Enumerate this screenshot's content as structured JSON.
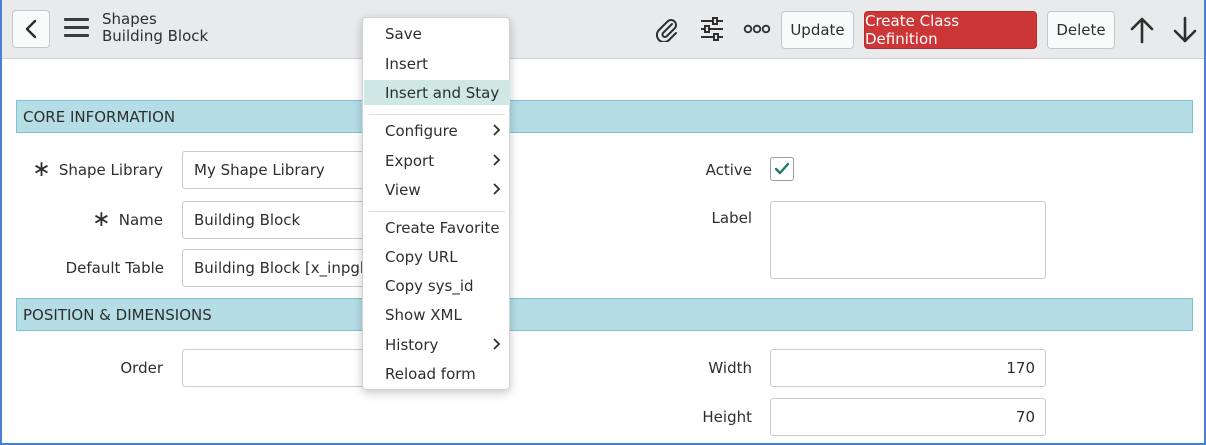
{
  "header": {
    "title": "Shapes",
    "subtitle": "Building Block",
    "update_label": "Update",
    "create_label": "Create Class Definition",
    "delete_label": "Delete",
    "icons": [
      "chevron-left-icon",
      "menu-icon",
      "paperclip-icon",
      "sliders-icon",
      "more-icon",
      "arrow-up-icon",
      "arrow-down-icon"
    ],
    "accent_color": "#cc3636"
  },
  "sections": {
    "core": "CORE INFORMATION",
    "position": "POSITION & DIMENSIONS",
    "section_color": "#b5dde6"
  },
  "form": {
    "shape_library": {
      "label": "Shape Library",
      "value": "My Shape Library",
      "required": true
    },
    "name": {
      "label": "Name",
      "value": "Building Block",
      "required": true
    },
    "default_table": {
      "label": "Default Table",
      "value": "Building Block [x_inpgh_u"
    },
    "active": {
      "label": "Active",
      "checked": true
    },
    "label_field": {
      "label": "Label",
      "value": ""
    },
    "order": {
      "label": "Order",
      "value": ""
    },
    "width": {
      "label": "Width",
      "value": "170"
    },
    "height": {
      "label": "Height",
      "value": "70"
    }
  },
  "context_menu": {
    "items": [
      {
        "label": "Save"
      },
      {
        "label": "Insert"
      },
      {
        "label": "Insert and Stay",
        "highlighted": true
      },
      {
        "label": "Configure",
        "submenu": true
      },
      {
        "label": "Export",
        "submenu": true
      },
      {
        "label": "View",
        "submenu": true
      },
      {
        "label": "Create Favorite"
      },
      {
        "label": "Copy URL"
      },
      {
        "label": "Copy sys_id"
      },
      {
        "label": "Show XML"
      },
      {
        "label": "History",
        "submenu": true
      },
      {
        "label": "Reload form"
      }
    ]
  }
}
